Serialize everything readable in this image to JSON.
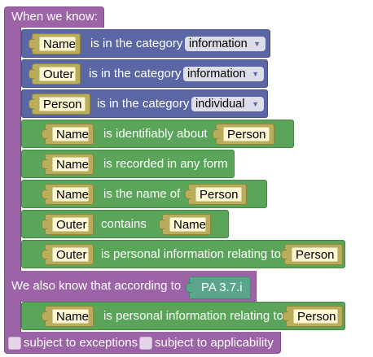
{
  "header": "When we know:",
  "category_blocks": [
    {
      "subject": "Name",
      "text": "is in the category",
      "category": "information"
    },
    {
      "subject": "Outer",
      "text": "is in the category",
      "category": "information"
    },
    {
      "subject": "Person",
      "text": "is in the category",
      "category": "individual"
    }
  ],
  "fact_blocks": [
    {
      "subject": "Name",
      "text": "is identifiably about",
      "object": "Person"
    },
    {
      "subject": "Name",
      "text": "is recorded in any form"
    },
    {
      "subject": "Name",
      "text": "is the name of",
      "object": "Person"
    },
    {
      "subject": "Outer",
      "text": "contains",
      "object": "Name"
    },
    {
      "subject": "Outer",
      "text": "is personal information relating to",
      "object": "Person"
    }
  ],
  "conclusion": {
    "text": "We also know that according to",
    "source": "PA 3.7.i",
    "block": {
      "subject": "Name",
      "text": "is personal information relating to",
      "object": "Person"
    }
  },
  "options": {
    "exceptions_label": "subject to exceptions",
    "applicability_label": "subject to applicability"
  },
  "colors": {
    "container": "#9c64a6",
    "category_block": "#5b67a5",
    "fact_block": "#5ba55b",
    "source_block": "#5ba58c",
    "variable_slot": "#b9ad5b"
  },
  "icons": {
    "dropdown": "triangle-down"
  }
}
